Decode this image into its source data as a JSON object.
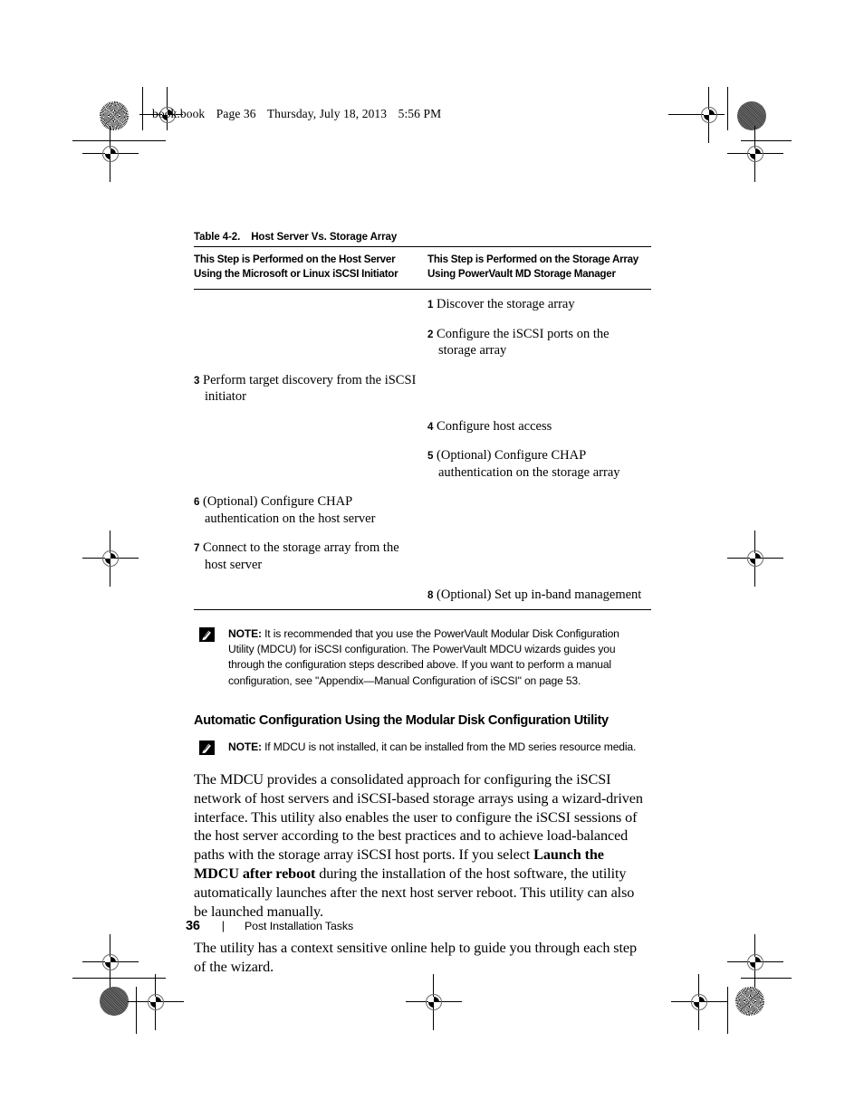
{
  "running_header": {
    "file": "book.book",
    "page_label": "Page 36",
    "date": "Thursday, July 18, 2013",
    "time": "5:56 PM"
  },
  "table": {
    "caption_label": "Table 4-2.",
    "caption_title": "Host Server Vs. Storage Array",
    "columns": [
      "This Step is Performed on the Host Server Using the Microsoft or Linux iSCSI Initiator",
      "This Step is Performed on the Storage Array Using PowerVault MD Storage Manager"
    ],
    "rows": [
      {
        "host_num": "",
        "host_text": "",
        "array_num": "1",
        "array_text": "Discover the storage array"
      },
      {
        "host_num": "",
        "host_text": "",
        "array_num": "2",
        "array_text": "Configure the iSCSI ports on the storage array"
      },
      {
        "host_num": "3",
        "host_text": "Perform target discovery from the iSCSI initiator",
        "array_num": "",
        "array_text": ""
      },
      {
        "host_num": "",
        "host_text": "",
        "array_num": "4",
        "array_text": "Configure host access"
      },
      {
        "host_num": "",
        "host_text": "",
        "array_num": "5",
        "array_text": "(Optional) Configure CHAP authentication on the storage array"
      },
      {
        "host_num": "6",
        "host_text": "(Optional) Configure CHAP authentication on the host server",
        "array_num": "",
        "array_text": ""
      },
      {
        "host_num": "7",
        "host_text": "Connect to the storage array from the host server",
        "array_num": "",
        "array_text": ""
      },
      {
        "host_num": "",
        "host_text": "",
        "array_num": "8",
        "array_text": "(Optional) Set up in-band management"
      }
    ]
  },
  "note_1": {
    "label": "NOTE:",
    "text": " It is recommended that you use the PowerVault Modular Disk Configuration Utility (MDCU) for iSCSI configuration. The PowerVault MDCU wizards guides you through the configuration steps described above. If you want to perform a manual configuration, see \"Appendix—Manual Configuration of iSCSI\" on page 53."
  },
  "section": {
    "heading": "Automatic Configuration Using the Modular Disk Configuration Utility"
  },
  "note_2": {
    "label": "NOTE:",
    "text": " If MDCU is not installed, it can be installed from the MD series resource media."
  },
  "paragraphs": {
    "p1_before": "The MDCU provides a consolidated approach for configuring the iSCSI network of host servers and iSCSI-based storage arrays using a wizard-driven interface. This utility also enables the user to configure the iSCSI sessions of the host server according to the best practices and to achieve load-balanced paths with the storage array iSCSI host ports. If you select ",
    "p1_bold": "Launch the MDCU after reboot",
    "p1_after": " during the installation of the host software, the utility automatically launches after the next host server reboot. This utility can also be launched manually.",
    "p2": "The utility has a context sensitive online help to guide you through each step of the wizard."
  },
  "footer": {
    "page_number": "36",
    "separator": "|",
    "chapter": "Post Installation Tasks"
  },
  "colors": {
    "text": "#000000",
    "rule": "#000000",
    "page_background": "#ffffff"
  }
}
